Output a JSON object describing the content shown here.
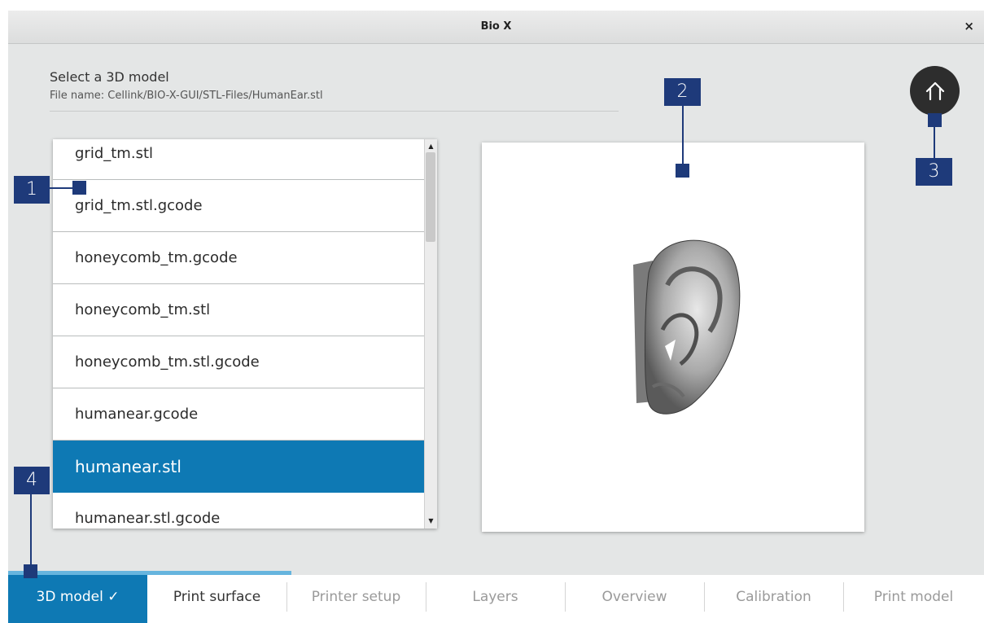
{
  "window": {
    "title": "Bio X",
    "close_glyph": "×"
  },
  "header": {
    "label": "Select a 3D model",
    "file_name": "File name: Cellink/BIO-X-GUI/STL-Files/HumanEar.stl"
  },
  "file_list": {
    "items": [
      "grid_tm.stl",
      "grid_tm.stl.gcode",
      "honeycomb_tm.gcode",
      "honeycomb_tm.stl",
      "honeycomb_tm.stl.gcode",
      "humanear.gcode",
      "humanear.stl",
      "humanear.stl.gcode"
    ],
    "selected": "humanear.stl",
    "scroll_up_glyph": "▲",
    "scroll_down_glyph": "▼"
  },
  "viewer": {
    "model": "human-ear-3d-model"
  },
  "home_button": {
    "icon": "home-icon"
  },
  "steps": {
    "tabs": [
      "3D model ✓",
      "Print surface",
      "Printer setup",
      "Layers",
      "Overview",
      "Calibration",
      "Print model"
    ],
    "active": "3D model ✓",
    "progress": 0.29
  },
  "callouts": [
    "1",
    "2",
    "3",
    "4"
  ],
  "colors": {
    "accent": "#0e79b4",
    "callout": "#1e3a7a",
    "progress": "#66b5de"
  }
}
